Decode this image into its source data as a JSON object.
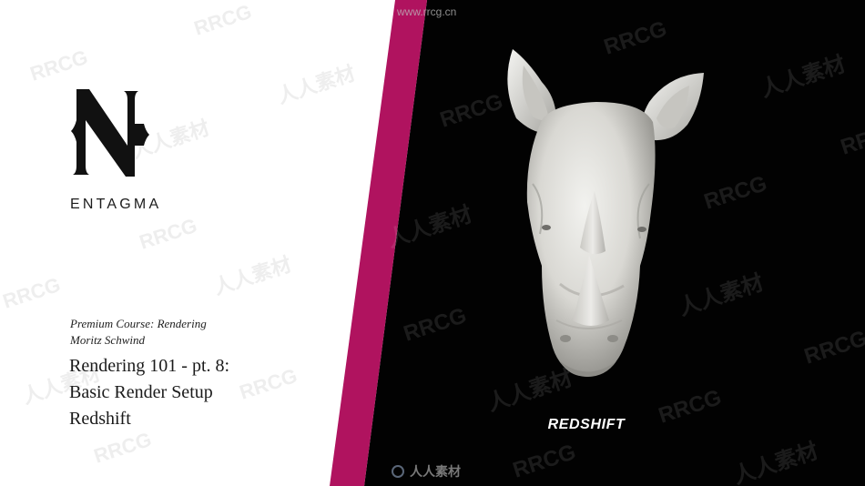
{
  "logo": {
    "letter": "N",
    "brand": "ENTAGMA"
  },
  "course": {
    "subtitle": "Premium Course: Rendering",
    "author": "Moritz Schwind",
    "title_lines": [
      "Rendering 101 - pt. 8:",
      "Basic Render Setup",
      "Redshift"
    ]
  },
  "render": {
    "label": "REDSHIFT",
    "subject_icon": "rhino-head-icon"
  },
  "colors": {
    "accent": "#b0135f",
    "background_left": "#ffffff",
    "background_right": "#020202"
  },
  "watermark": {
    "url": "www.rrcg.cn",
    "latin": "RRCG",
    "cjk": "人人素材",
    "bottom": "人人素材"
  }
}
